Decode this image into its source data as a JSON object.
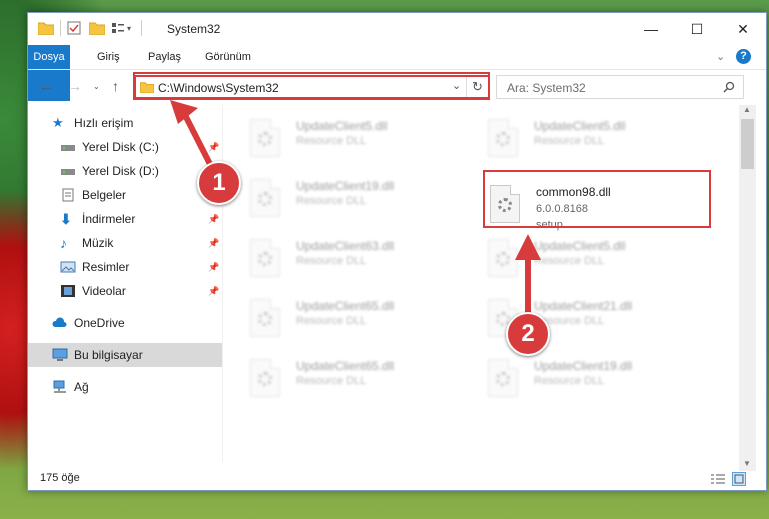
{
  "window": {
    "title": "System32",
    "minimize": "—",
    "maximize": "☐",
    "close": "✕"
  },
  "ribbon": {
    "tabs": [
      "Dosya",
      "Giriş",
      "Paylaş",
      "Görünüm"
    ]
  },
  "address": {
    "path": "C:\\Windows\\System32",
    "search_placeholder": "Ara: System32"
  },
  "nav": {
    "quick_access": "Hızlı erişim",
    "items": [
      "Yerel Disk (C:)",
      "Yerel Disk (D:)",
      "Belgeler",
      "İndirmeler",
      "Müzik",
      "Resimler",
      "Videolar"
    ],
    "onedrive": "OneDrive",
    "this_pc": "Bu bilgisayar",
    "network": "Ağ"
  },
  "files": {
    "left": [
      {
        "name": "UpdateClient5.dll",
        "type": "Resource DLL"
      },
      {
        "name": "UpdateClient19.dll",
        "type": "Resource DLL"
      },
      {
        "name": "UpdateClient63.dll",
        "type": "Resource DLL"
      },
      {
        "name": "UpdateClient65.dll",
        "type": "Resource DLL"
      },
      {
        "name": "UpdateClient65.dll",
        "type": "Resource DLL"
      }
    ],
    "right": [
      {
        "name": "UpdateClient5.dll",
        "type": "Resource DLL"
      },
      {
        "name": "UpdateClient5.dll",
        "type": "Resource DLL"
      },
      {
        "name": "UpdateClient21.dll",
        "type": "Resource DLL"
      },
      {
        "name": "UpdateClient19.dll",
        "type": "Resource DLL"
      }
    ],
    "highlighted": {
      "name": "common98.dll",
      "version": "6.0.0.8168",
      "type": "setup"
    }
  },
  "status": {
    "count": "175 öğe"
  },
  "annotations": [
    "1",
    "2"
  ],
  "colors": {
    "accent": "#1979ca",
    "highlight": "#d83b3b"
  }
}
